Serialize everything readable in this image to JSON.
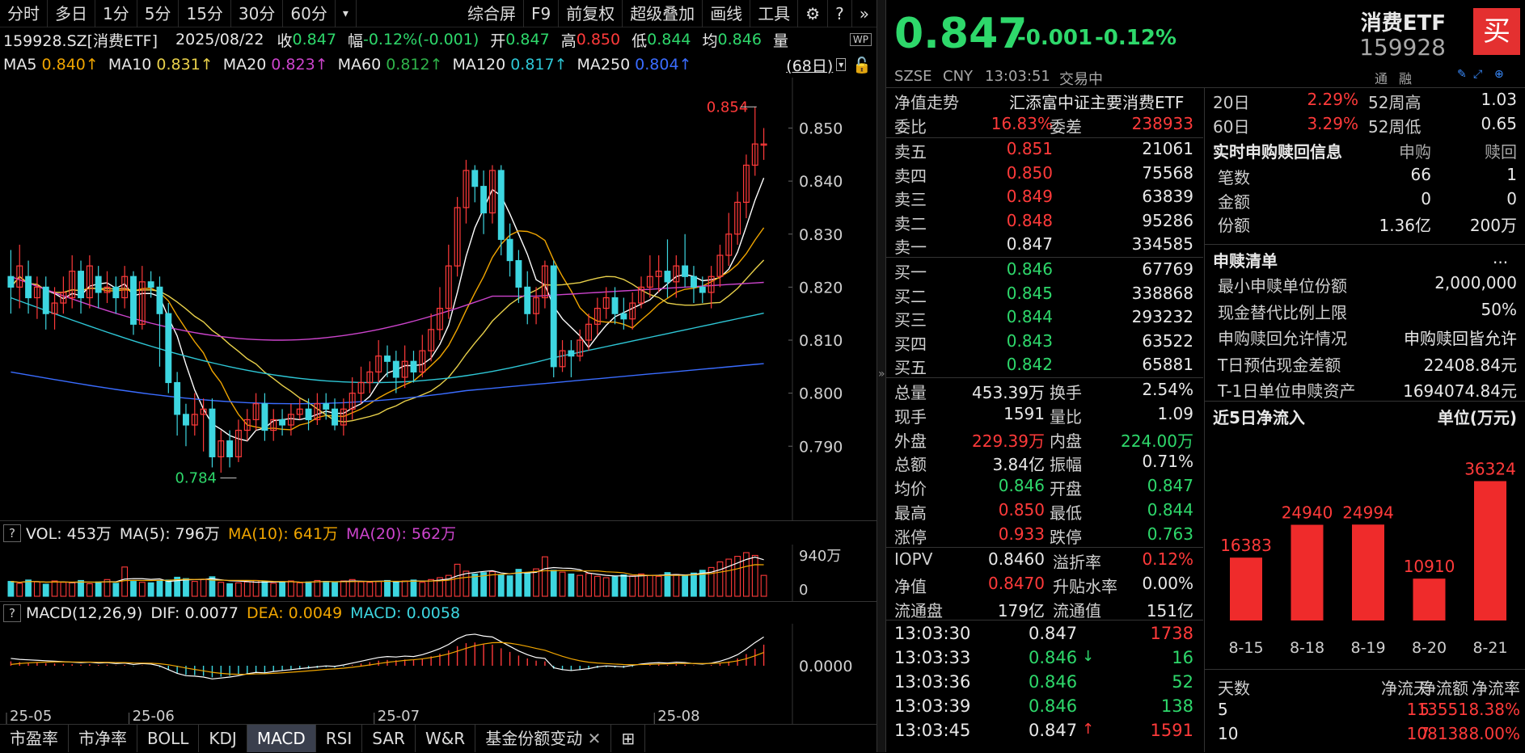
{
  "toolbar": {
    "tabs": [
      "分时",
      "多日",
      "1分",
      "5分",
      "15分",
      "30分",
      "60分"
    ],
    "dropdown": "▾",
    "right": [
      "综合屏",
      "F9",
      "前复权",
      "超级叠加",
      "画线",
      "工具"
    ]
  },
  "info": {
    "code": "159928.SZ[消费ETF]",
    "date": "2025/08/22",
    "close_label": "收",
    "close": "0.847",
    "range_label": "幅",
    "range": "-0.12%(-0.001)",
    "open_label": "开",
    "open": "0.847",
    "high_label": "高",
    "high": "0.850",
    "low_label": "低",
    "low": "0.844",
    "avg_label": "均",
    "avg": "0.846",
    "vol_label": "量"
  },
  "ma": {
    "ma5_label": "MA5",
    "ma5": "0.840↑",
    "ma10_label": "MA10",
    "ma10": "0.831↑",
    "ma20_label": "MA20",
    "ma20": "0.823↑",
    "ma60_label": "MA60",
    "ma60": "0.812↑",
    "ma120_label": "MA120",
    "ma120": "0.817↑",
    "ma250_label": "MA250",
    "ma250": "0.804↑",
    "days": "(68日)"
  },
  "colors": {
    "ma5": "#ffffff",
    "ma10": "#f0a500",
    "ma20": "#e8d04a",
    "ma60": "#cc44cc",
    "ma120": "#2fb34a",
    "ma250": "#3a6cff",
    "ma120b": "#2ec7d6",
    "up": "#ff3a3a",
    "down": "#3dd6e0"
  },
  "chart_data": {
    "type": "candlestick",
    "ylim": [
      0.778,
      0.858
    ],
    "yticks": [
      "0.850",
      "0.840",
      "0.830",
      "0.820",
      "0.810",
      "0.800",
      "0.790"
    ],
    "xticks": [
      "25-05",
      "25-06",
      "25-07",
      "25-08"
    ],
    "high_marker": "0.854",
    "low_marker": "0.784",
    "candles": [
      [
        0.822,
        0.82,
        0.827,
        0.815
      ],
      [
        0.82,
        0.824,
        0.828,
        0.816
      ],
      [
        0.822,
        0.818,
        0.825,
        0.815
      ],
      [
        0.818,
        0.82,
        0.822,
        0.814
      ],
      [
        0.82,
        0.815,
        0.822,
        0.812
      ],
      [
        0.815,
        0.817,
        0.82,
        0.812
      ],
      [
        0.817,
        0.819,
        0.822,
        0.815
      ],
      [
        0.818,
        0.823,
        0.826,
        0.816
      ],
      [
        0.823,
        0.818,
        0.825,
        0.815
      ],
      [
        0.818,
        0.824,
        0.826,
        0.816
      ],
      [
        0.822,
        0.819,
        0.824,
        0.816
      ],
      [
        0.819,
        0.82,
        0.823,
        0.817
      ],
      [
        0.82,
        0.818,
        0.822,
        0.815
      ],
      [
        0.818,
        0.822,
        0.824,
        0.816
      ],
      [
        0.822,
        0.813,
        0.823,
        0.811
      ],
      [
        0.813,
        0.821,
        0.824,
        0.812
      ],
      [
        0.821,
        0.82,
        0.823,
        0.818
      ],
      [
        0.82,
        0.815,
        0.822,
        0.805
      ],
      [
        0.815,
        0.802,
        0.817,
        0.8
      ],
      [
        0.802,
        0.796,
        0.804,
        0.792
      ],
      [
        0.796,
        0.794,
        0.798,
        0.79
      ],
      [
        0.794,
        0.796,
        0.8,
        0.792
      ],
      [
        0.796,
        0.797,
        0.799,
        0.789
      ],
      [
        0.797,
        0.788,
        0.799,
        0.786
      ],
      [
        0.788,
        0.791,
        0.793,
        0.785
      ],
      [
        0.791,
        0.788,
        0.793,
        0.786
      ],
      [
        0.788,
        0.793,
        0.795,
        0.787
      ],
      [
        0.793,
        0.795,
        0.797,
        0.791
      ],
      [
        0.795,
        0.798,
        0.8,
        0.793
      ],
      [
        0.798,
        0.793,
        0.8,
        0.791
      ],
      [
        0.793,
        0.795,
        0.797,
        0.791
      ],
      [
        0.795,
        0.794,
        0.797,
        0.792
      ],
      [
        0.794,
        0.796,
        0.798,
        0.792
      ],
      [
        0.796,
        0.797,
        0.799,
        0.795
      ],
      [
        0.797,
        0.795,
        0.799,
        0.793
      ],
      [
        0.795,
        0.798,
        0.8,
        0.794
      ],
      [
        0.798,
        0.797,
        0.8,
        0.795
      ],
      [
        0.797,
        0.794,
        0.799,
        0.793
      ],
      [
        0.794,
        0.797,
        0.799,
        0.792
      ],
      [
        0.797,
        0.8,
        0.803,
        0.795
      ],
      [
        0.8,
        0.802,
        0.805,
        0.798
      ],
      [
        0.802,
        0.804,
        0.806,
        0.8
      ],
      [
        0.804,
        0.807,
        0.81,
        0.802
      ],
      [
        0.807,
        0.806,
        0.809,
        0.803
      ],
      [
        0.806,
        0.803,
        0.808,
        0.8
      ],
      [
        0.803,
        0.806,
        0.809,
        0.801
      ],
      [
        0.806,
        0.804,
        0.808,
        0.802
      ],
      [
        0.804,
        0.808,
        0.811,
        0.803
      ],
      [
        0.808,
        0.812,
        0.815,
        0.806
      ],
      [
        0.812,
        0.816,
        0.82,
        0.81
      ],
      [
        0.816,
        0.824,
        0.828,
        0.814
      ],
      [
        0.824,
        0.835,
        0.837,
        0.822
      ],
      [
        0.835,
        0.842,
        0.844,
        0.832
      ],
      [
        0.842,
        0.839,
        0.843,
        0.836
      ],
      [
        0.839,
        0.834,
        0.842,
        0.83
      ],
      [
        0.834,
        0.842,
        0.843,
        0.832
      ],
      [
        0.842,
        0.829,
        0.843,
        0.826
      ],
      [
        0.829,
        0.825,
        0.832,
        0.822
      ],
      [
        0.825,
        0.82,
        0.827,
        0.817
      ],
      [
        0.82,
        0.815,
        0.823,
        0.813
      ],
      [
        0.815,
        0.818,
        0.82,
        0.813
      ],
      [
        0.818,
        0.824,
        0.825,
        0.816
      ],
      [
        0.824,
        0.805,
        0.825,
        0.803
      ],
      [
        0.805,
        0.808,
        0.81,
        0.804
      ],
      [
        0.808,
        0.807,
        0.81,
        0.803
      ],
      [
        0.807,
        0.81,
        0.812,
        0.806
      ],
      [
        0.81,
        0.813,
        0.815,
        0.808
      ],
      [
        0.813,
        0.816,
        0.818,
        0.811
      ],
      [
        0.816,
        0.818,
        0.82,
        0.814
      ],
      [
        0.818,
        0.815,
        0.82,
        0.813
      ],
      [
        0.815,
        0.814,
        0.818,
        0.812
      ],
      [
        0.814,
        0.817,
        0.819,
        0.812
      ],
      [
        0.817,
        0.82,
        0.822,
        0.816
      ],
      [
        0.82,
        0.822,
        0.826,
        0.818
      ],
      [
        0.822,
        0.823,
        0.826,
        0.819
      ],
      [
        0.823,
        0.821,
        0.829,
        0.818
      ],
      [
        0.821,
        0.824,
        0.826,
        0.818
      ],
      [
        0.824,
        0.822,
        0.83,
        0.82
      ],
      [
        0.822,
        0.82,
        0.824,
        0.817
      ],
      [
        0.82,
        0.819,
        0.822,
        0.817
      ],
      [
        0.819,
        0.822,
        0.824,
        0.816
      ],
      [
        0.822,
        0.826,
        0.828,
        0.82
      ],
      [
        0.826,
        0.83,
        0.834,
        0.824
      ],
      [
        0.83,
        0.836,
        0.838,
        0.828
      ],
      [
        0.836,
        0.843,
        0.845,
        0.833
      ],
      [
        0.843,
        0.847,
        0.854,
        0.841
      ],
      [
        0.847,
        0.847,
        0.85,
        0.844
      ]
    ],
    "volume_ylabel": "940万",
    "volume_zero": "0",
    "volumes": [
      3.2,
      2.8,
      3.5,
      3.1,
      2.6,
      3.3,
      3.0,
      2.9,
      3.4,
      2.7,
      3.1,
      3.6,
      2.8,
      6.3,
      3.2,
      3.0,
      2.9,
      3.3,
      3.5,
      4.1,
      3.8,
      3.2,
      3.6,
      4.2,
      3.0,
      2.7,
      2.9,
      3.1,
      3.4,
      3.2,
      2.8,
      3.0,
      3.3,
      2.9,
      3.1,
      3.4,
      3.2,
      3.0,
      3.3,
      3.6,
      3.1,
      3.0,
      3.2,
      3.4,
      3.1,
      3.3,
      3.5,
      3.0,
      3.6,
      4.0,
      4.5,
      6.9,
      5.4,
      4.8,
      5.1,
      5.3,
      4.6,
      4.4,
      5.8,
      5.1,
      5.9,
      8.5,
      5.6,
      5.2,
      4.8,
      4.5,
      4.9,
      4.3,
      4.0,
      4.2,
      4.6,
      4.4,
      4.8,
      4.5,
      4.3,
      5.1,
      4.7,
      4.4,
      5.0,
      5.6,
      6.2,
      7.4,
      8.0,
      8.6,
      9.4,
      8.8,
      4.5
    ],
    "macd_zero": "0.0000",
    "macd_hist": [
      0.0012,
      0.001,
      0.0009,
      0.0008,
      0.0007,
      0.0006,
      0.0005,
      0.0004,
      0.0003,
      0.0004,
      0.0002,
      0.0003,
      0.0001,
      0.0002,
      -0.0001,
      0.0001,
      0.0,
      -0.0004,
      -0.0012,
      -0.002,
      -0.0025,
      -0.0026,
      -0.0028,
      -0.0032,
      -0.003,
      -0.0028,
      -0.0025,
      -0.0021,
      -0.0018,
      -0.0019,
      -0.0016,
      -0.0014,
      -0.0012,
      -0.001,
      -0.0008,
      -0.0006,
      -0.0004,
      -0.0005,
      -0.0002,
      0.0002,
      0.0006,
      0.001,
      0.0014,
      0.0016,
      0.0015,
      0.0017,
      0.0016,
      0.002,
      0.0026,
      0.0033,
      0.0042,
      0.0054,
      0.0062,
      0.0064,
      0.006,
      0.0058,
      0.0048,
      0.0038,
      0.0028,
      0.002,
      0.0014,
      0.0012,
      -0.0008,
      -0.0012,
      -0.0014,
      -0.0012,
      -0.001,
      -0.0006,
      -0.0004,
      -0.0005,
      -0.0006,
      -0.0003,
      0.0,
      0.0002,
      0.0003,
      0.0002,
      0.0004,
      0.0003,
      0.0001,
      0.0,
      0.0002,
      0.0006,
      0.0012,
      0.002,
      0.0032,
      0.0046,
      0.0058
    ]
  },
  "tabs_bottom": [
    "市盈率",
    "市净率",
    "BOLL",
    "KDJ",
    "MACD",
    "RSI",
    "SAR",
    "W&R",
    "基金份额变动"
  ],
  "vol_info": {
    "q": "?",
    "label": "VOL: 453万",
    "ma5": "MA(5): 796万",
    "ma10": "MA(10): 641万",
    "ma20": "MA(20): 562万"
  },
  "macd_info": {
    "q": "?",
    "label": "MACD(12,26,9)",
    "dif": "DIF: 0.0077",
    "dea": "DEA: 0.0049",
    "macd": "MACD: 0.0058"
  },
  "quote": {
    "price": "0.847",
    "chg": "-0.001",
    "pct": "-0.12%",
    "name": "消费ETF",
    "code": "159928",
    "buy_btn": "买",
    "exchange": "SZSE",
    "currency": "CNY",
    "time": "13:03:51",
    "status": "交易中",
    "tong": "通",
    "rong": "融"
  },
  "nav": {
    "label": "净值走势",
    "fund": "汇添富中证主要消费ETF",
    "weibi_label": "委比",
    "weibi": "16.83%",
    "weicha_label": "委差",
    "weicha": "238933"
  },
  "asks": [
    {
      "l": "卖五",
      "p": "0.851",
      "v": "21061"
    },
    {
      "l": "卖四",
      "p": "0.850",
      "v": "75568"
    },
    {
      "l": "卖三",
      "p": "0.849",
      "v": "63839"
    },
    {
      "l": "卖二",
      "p": "0.848",
      "v": "95286"
    },
    {
      "l": "卖一",
      "p": "0.847",
      "v": "334585"
    }
  ],
  "bids": [
    {
      "l": "买一",
      "p": "0.846",
      "v": "67769"
    },
    {
      "l": "买二",
      "p": "0.845",
      "v": "338868"
    },
    {
      "l": "买三",
      "p": "0.844",
      "v": "293232"
    },
    {
      "l": "买四",
      "p": "0.843",
      "v": "63522"
    },
    {
      "l": "买五",
      "p": "0.842",
      "v": "65881"
    }
  ],
  "stats": [
    [
      "总量",
      "453.39万",
      "换手",
      "2.54%"
    ],
    [
      "现手",
      "1591",
      "量比",
      "1.09"
    ],
    [
      "外盘",
      "229.39万",
      "内盘",
      "224.00万"
    ],
    [
      "总额",
      "3.84亿",
      "振幅",
      "0.71%"
    ],
    [
      "均价",
      "0.846",
      "开盘",
      "0.847"
    ],
    [
      "最高",
      "0.850",
      "最低",
      "0.844"
    ],
    [
      "涨停",
      "0.933",
      "跌停",
      "0.763"
    ]
  ],
  "iopv": [
    [
      "IOPV",
      "0.8460",
      "溢折率",
      "0.12%"
    ],
    [
      "净值",
      "0.8470",
      "升贴水率",
      "0.00%"
    ],
    [
      "流通盘",
      "179亿",
      "流通值",
      "151亿"
    ]
  ],
  "ticks": [
    {
      "t": "13:03:30",
      "p": "0.847",
      "a": "",
      "v": "1738"
    },
    {
      "t": "13:03:33",
      "p": "0.846",
      "a": "↓",
      "v": "16"
    },
    {
      "t": "13:03:36",
      "p": "0.846",
      "a": "",
      "v": "52"
    },
    {
      "t": "13:03:39",
      "p": "0.846",
      "a": "",
      "v": "138"
    },
    {
      "t": "13:03:45",
      "p": "0.847",
      "a": "↑",
      "v": "1591"
    }
  ],
  "perf": {
    "d20_label": "20日",
    "d20": "2.29%",
    "w52h_label": "52周高",
    "w52h": "1.03",
    "d60_label": "60日",
    "d60": "3.29%",
    "w52l_label": "52周低",
    "w52l": "0.65"
  },
  "redeem": {
    "title": "实时申购赎回信息",
    "sub_label": "申购",
    "red_label": "赎回",
    "rows": [
      [
        "笔数",
        "66",
        "1"
      ],
      [
        "金额",
        "0",
        "0"
      ],
      [
        "份额",
        "1.36亿",
        "200万"
      ]
    ]
  },
  "list": {
    "title": "申赎清单",
    "more": "...",
    "rows": [
      [
        "最小申赎单位份额",
        "2,000,000"
      ],
      [
        "现金替代比例上限",
        "50%"
      ],
      [
        "申购赎回允许情况",
        "申购赎回皆允许"
      ],
      [
        "T日预估现金差额",
        "22408.84元"
      ],
      [
        "T-1日单位申赎资产",
        "1694074.84元"
      ]
    ]
  },
  "inflow": {
    "title": "近5日净流入",
    "unit": "单位(万元)",
    "dates": [
      "8-15",
      "8-18",
      "8-19",
      "8-20",
      "8-21"
    ],
    "values": [
      16383,
      24940,
      24994,
      10910,
      36324
    ]
  },
  "flow_table": {
    "headers": [
      "天数",
      "净流天",
      "净流额",
      "净流率"
    ],
    "rows": [
      [
        "5",
        "5",
        "113551",
        "8.38%"
      ],
      [
        "10",
        "7",
        "108138",
        "8.00%"
      ]
    ]
  }
}
